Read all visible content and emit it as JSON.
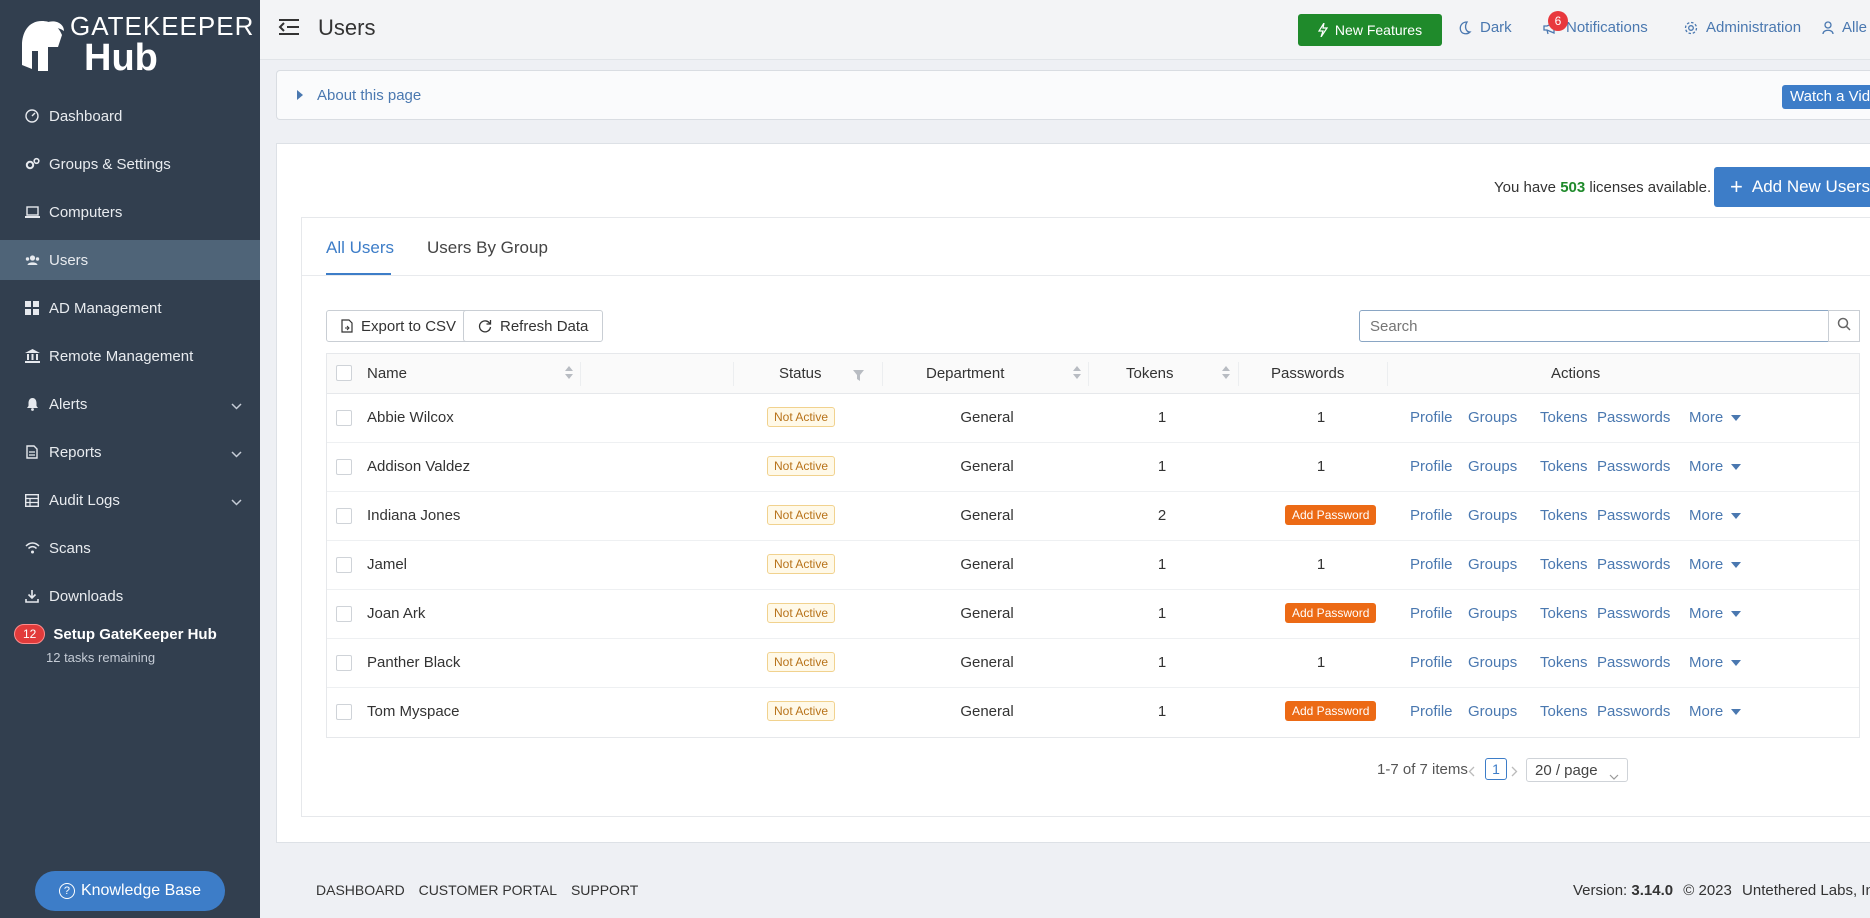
{
  "brand": {
    "top": "GATEKEEPER",
    "bottom": "Hub"
  },
  "sidebar": {
    "items": [
      {
        "label": "Dashboard",
        "icon": "dashboard-icon"
      },
      {
        "label": "Groups & Settings",
        "icon": "gears-icon"
      },
      {
        "label": "Computers",
        "icon": "laptop-icon"
      },
      {
        "label": "Users",
        "icon": "users-icon",
        "active": true
      },
      {
        "label": "AD Management",
        "icon": "windows-icon"
      },
      {
        "label": "Remote Management",
        "icon": "bank-icon"
      },
      {
        "label": "Alerts",
        "icon": "bell-icon"
      },
      {
        "label": "Reports",
        "icon": "file-icon"
      },
      {
        "label": "Audit Logs",
        "icon": "table-icon"
      },
      {
        "label": "Scans",
        "icon": "wifi-icon"
      },
      {
        "label": "Downloads",
        "icon": "download-icon"
      }
    ],
    "setup": {
      "count": "12",
      "title": "Setup GateKeeper Hub",
      "sub": "12 tasks remaining"
    },
    "knowledge_base": "Knowledge Base"
  },
  "topbar": {
    "title": "Users",
    "new_features": "New Features",
    "dark": "Dark",
    "notifications": "Notifications",
    "notif_count": "6",
    "administration": "Administration",
    "user": "Alle"
  },
  "about": {
    "label": "About this page",
    "watch": "Watch a Vide"
  },
  "licenses": {
    "prefix": "You have",
    "count": "503",
    "suffix": "licenses available."
  },
  "add_users": "Add New Users",
  "tabs": {
    "all": "All Users",
    "by_group": "Users By Group"
  },
  "toolbar": {
    "export": "Export to CSV",
    "refresh": "Refresh Data",
    "search_placeholder": "Search"
  },
  "table": {
    "headers": {
      "name": "Name",
      "status": "Status",
      "department": "Department",
      "tokens": "Tokens",
      "passwords": "Passwords",
      "actions": "Actions"
    },
    "actions": {
      "profile": "Profile",
      "groups": "Groups",
      "tokens": "Tokens",
      "passwords": "Passwords",
      "more": "More"
    },
    "rows": [
      {
        "name": "Abbie Wilcox",
        "status": "Not Active",
        "department": "General",
        "tokens": "1",
        "passwords": "1"
      },
      {
        "name": "Addison Valdez",
        "status": "Not Active",
        "department": "General",
        "tokens": "1",
        "passwords": "1"
      },
      {
        "name": "Indiana Jones",
        "status": "Not Active",
        "department": "General",
        "tokens": "2",
        "passwords": "Add Password"
      },
      {
        "name": "Jamel",
        "status": "Not Active",
        "department": "General",
        "tokens": "1",
        "passwords": "1"
      },
      {
        "name": "Joan Ark",
        "status": "Not Active",
        "department": "General",
        "tokens": "1",
        "passwords": "Add Password"
      },
      {
        "name": "Panther Black",
        "status": "Not Active",
        "department": "General",
        "tokens": "1",
        "passwords": "1"
      },
      {
        "name": "Tom Myspace",
        "status": "Not Active",
        "department": "General",
        "tokens": "1",
        "passwords": "Add Password"
      }
    ]
  },
  "pagination": {
    "range": "1-7 of 7 items",
    "page": "1",
    "page_size": "20 / page"
  },
  "footer": {
    "links": [
      "DASHBOARD",
      "CUSTOMER PORTAL",
      "SUPPORT"
    ],
    "version_label": "Version:",
    "version": "3.14.0",
    "copyright": "© 2023",
    "company": "Untethered Labs, Inc."
  },
  "colors": {
    "sidebar": "#323f4f",
    "accent": "#3d7dc8",
    "success": "#1f8a2b",
    "warning": "#ec6a15",
    "danger": "#e23b3b"
  }
}
